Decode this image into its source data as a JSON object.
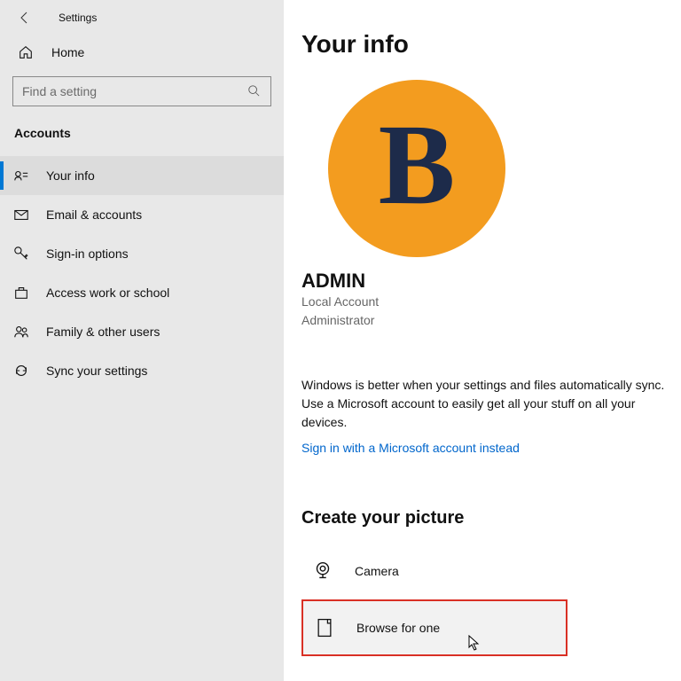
{
  "header": {
    "title": "Settings"
  },
  "sidebar": {
    "home_label": "Home",
    "search_placeholder": "Find a setting",
    "category": "Accounts",
    "items": [
      {
        "label": "Your info"
      },
      {
        "label": "Email & accounts"
      },
      {
        "label": "Sign-in options"
      },
      {
        "label": "Access work or school"
      },
      {
        "label": "Family & other users"
      },
      {
        "label": "Sync your settings"
      }
    ]
  },
  "main": {
    "heading": "Your info",
    "avatar_letter": "B",
    "username": "ADMIN",
    "account_type": "Local Account",
    "role": "Administrator",
    "sync_text": "Windows is better when your settings and files automatically sync. Use a Microsoft account to easily get all your stuff on all your devices.",
    "link_text": "Sign in with a Microsoft account instead",
    "section_heading": "Create your picture",
    "options": {
      "camera": "Camera",
      "browse": "Browse for one"
    }
  }
}
